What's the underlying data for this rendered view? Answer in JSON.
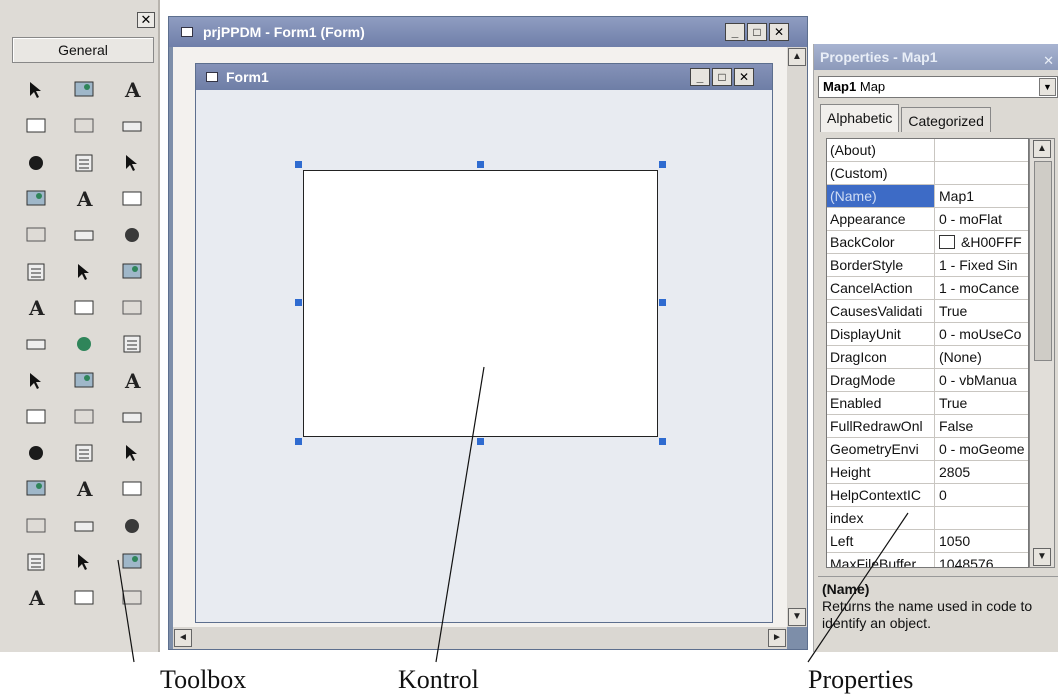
{
  "toolbox": {
    "close_glyph": "✕",
    "general_label": "General",
    "tools": [
      "pointer-icon",
      "picturebox-icon",
      "label-icon",
      "textbox-icon",
      "frame-icon",
      "commandbutton-icon",
      "checkbox-icon",
      "optionbutton-icon",
      "combobox-icon",
      "listbox-icon",
      "hscrollbar-icon",
      "vscrollbar-icon",
      "timer-icon",
      "drivelistbox-icon",
      "dirlistbox-icon",
      "filelistbox-icon",
      "shape-icon",
      "line-icon",
      "image-icon",
      "data-icon",
      "ole-icon",
      "globe-icon",
      "animation-icon",
      "mouse-icon",
      "slider-icon",
      "toolbar-icon",
      "progressbar-icon",
      "treeview-icon",
      "listview-icon",
      "imagelist-icon",
      "statusbar-icon",
      "tabstrip-icon",
      "map-icon",
      "calendar-icon",
      "document-icon",
      "richtext-icon",
      "grid-icon",
      "flexgrid-icon",
      "datarepeater-icon",
      "coolbar-icon",
      "updown-icon",
      "imagecombo-icon",
      "spin-icon",
      "monthview-icon",
      "window-icon"
    ]
  },
  "project_window": {
    "title": "prjPPDM - Form1 (Form)",
    "buttons": {
      "minimize": "_",
      "maximize": "□",
      "close": "✕"
    },
    "scroll": {
      "up": "▲",
      "down": "▼",
      "left": "◄",
      "right": "►"
    }
  },
  "form_window": {
    "title": "Form1",
    "buttons": {
      "minimize": "_",
      "maximize": "□",
      "close": "✕"
    }
  },
  "properties": {
    "title": "Properties - Map1",
    "close_glyph": "✕",
    "object_name": "Map1",
    "object_type": "Map",
    "dropdown_glyph": "▼",
    "tabs": [
      "Alphabetic",
      "Categorized"
    ],
    "rows": [
      {
        "name": "(About)",
        "value": ""
      },
      {
        "name": "(Custom)",
        "value": ""
      },
      {
        "name": "(Name)",
        "value": "Map1"
      },
      {
        "name": "Appearance",
        "value": "0 - moFlat"
      },
      {
        "name": "BackColor",
        "value": "&H00FFF"
      },
      {
        "name": "BorderStyle",
        "value": "1 - Fixed Sin"
      },
      {
        "name": "CancelAction",
        "value": "1 - moCance"
      },
      {
        "name": "CausesValidati",
        "value": "True"
      },
      {
        "name": "DisplayUnit",
        "value": "0 - moUseCo"
      },
      {
        "name": "DragIcon",
        "value": "(None)"
      },
      {
        "name": "DragMode",
        "value": "0 - vbManua"
      },
      {
        "name": "Enabled",
        "value": "True"
      },
      {
        "name": "FullRedrawOnl",
        "value": "False"
      },
      {
        "name": "GeometryEnvi",
        "value": "0 - moGeome"
      },
      {
        "name": "Height",
        "value": "2805"
      },
      {
        "name": "HelpContextIC",
        "value": "0"
      },
      {
        "name": "index",
        "value": ""
      },
      {
        "name": "Left",
        "value": "1050"
      },
      {
        "name": "MaxFileBuffer",
        "value": "1048576"
      }
    ],
    "selected_row": "(Name)",
    "description_title": "(Name)",
    "description_text": "Returns the name used in code to identify an object."
  },
  "captions": {
    "toolbox": "Toolbox",
    "kontrol": "Kontrol",
    "properties": "Properties"
  },
  "colors": {
    "titlebar_active": "#6f7fa9",
    "selection": "#3d6bc6",
    "handle": "#2f6bd0"
  }
}
